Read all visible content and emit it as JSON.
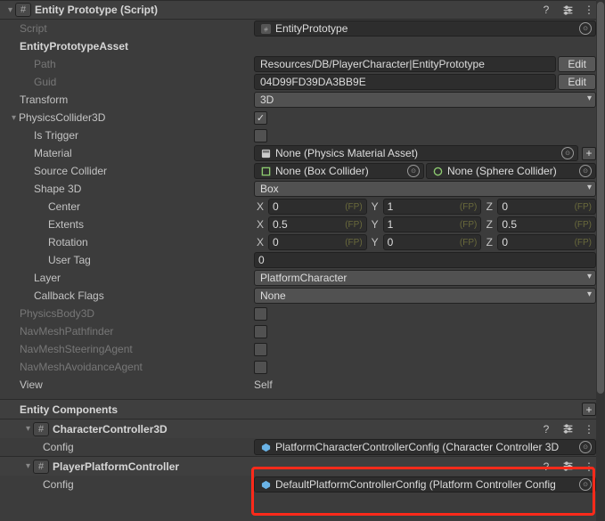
{
  "header": {
    "title": "Entity Prototype (Script)",
    "help": "?",
    "preset_icon": "sliders-icon",
    "menu_icon": "kebab-icon",
    "chip": "#"
  },
  "script": {
    "label": "Script",
    "value": "EntityPrototype"
  },
  "asset": {
    "label": "EntityPrototypeAsset",
    "path_label": "Path",
    "path_value": "Resources/DB/PlayerCharacter|EntityPrototype",
    "guid_label": "Guid",
    "guid_value": "04D99FD39DA3BB9E",
    "edit": "Edit"
  },
  "transform": {
    "label": "Transform",
    "value": "3D"
  },
  "collider": {
    "label": "PhysicsCollider3D",
    "enabled": true,
    "is_trigger": {
      "label": "Is Trigger",
      "value": false
    },
    "material": {
      "label": "Material",
      "value": "None (Physics Material Asset)"
    },
    "source": {
      "label": "Source Collider",
      "box": "None (Box Collider)",
      "sphere": "None (Sphere Collider)"
    },
    "shape": {
      "label": "Shape 3D",
      "value": "Box"
    },
    "center": {
      "label": "Center",
      "x": "0",
      "y": "1",
      "z": "0"
    },
    "extents": {
      "label": "Extents",
      "x": "0.5",
      "y": "1",
      "z": "0.5"
    },
    "rotation": {
      "label": "Rotation",
      "x": "0",
      "y": "0",
      "z": "0"
    },
    "usertag": {
      "label": "User Tag",
      "value": "0"
    },
    "layer": {
      "label": "Layer",
      "value": "PlatformCharacter"
    },
    "callback": {
      "label": "Callback Flags",
      "value": "None"
    },
    "fp": "(FP)"
  },
  "body": {
    "label": "PhysicsBody3D"
  },
  "navpath": {
    "label": "NavMeshPathfinder"
  },
  "navsteer": {
    "label": "NavMeshSteeringAgent"
  },
  "navavoid": {
    "label": "NavMeshAvoidanceAgent"
  },
  "view": {
    "label": "View",
    "value": "Self"
  },
  "components": {
    "heading": "Entity Components",
    "cc": {
      "name": "CharacterController3D",
      "config_label": "Config",
      "config_value": "PlatformCharacterControllerConfig (Character Controller 3D"
    },
    "pp": {
      "name": "PlayerPlatformController",
      "config_label": "Config",
      "config_value": "DefaultPlatformControllerConfig (Platform Controller Config"
    }
  }
}
